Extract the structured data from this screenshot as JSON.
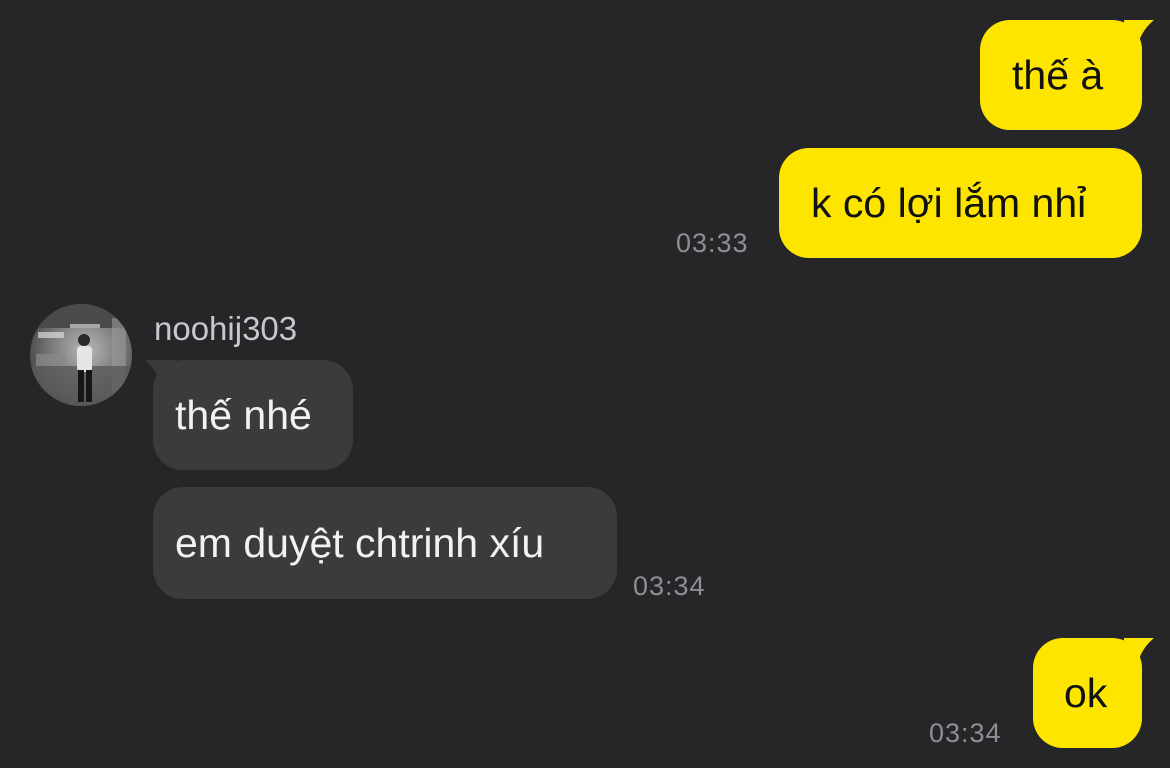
{
  "conversation": {
    "messages": [
      {
        "direction": "outgoing",
        "text": "thế à"
      },
      {
        "direction": "outgoing",
        "text": "k có lợi lắm nhỉ",
        "time": "03:33"
      },
      {
        "direction": "incoming",
        "sender": "noohij303",
        "text": "thế nhé"
      },
      {
        "direction": "incoming",
        "text": "em duyệt chtrinh xíu",
        "time": "03:34"
      },
      {
        "direction": "outgoing",
        "text": "ok",
        "time": "03:34"
      }
    ]
  },
  "colors": {
    "background": "#262628",
    "outgoing_bubble": "#FEE500",
    "incoming_bubble": "#3b3b3e",
    "timestamp": "#8e8e93"
  },
  "icons": {
    "avatar": "profile-photo-avatar"
  }
}
